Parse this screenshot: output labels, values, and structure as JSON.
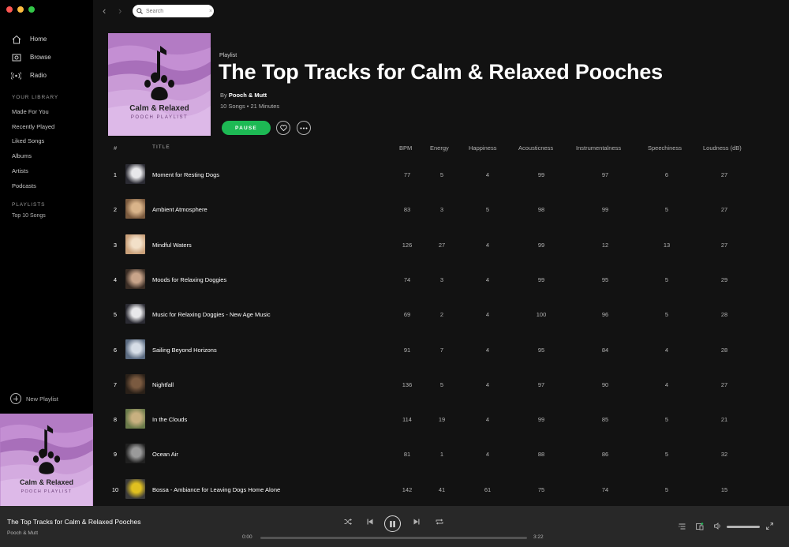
{
  "sidebar": {
    "nav": [
      {
        "label": "Home",
        "icon": "home-icon"
      },
      {
        "label": "Browse",
        "icon": "browse-icon"
      },
      {
        "label": "Radio",
        "icon": "radio-icon"
      }
    ],
    "library_heading": "YOUR LIBRARY",
    "library_items": [
      "Made For You",
      "Recently Played",
      "Liked Songs",
      "Albums",
      "Artists",
      "Podcasts"
    ],
    "playlists_heading": "PLAYLISTS",
    "playlists": [
      "Top 10 Songs"
    ],
    "new_playlist_label": "New Playlist"
  },
  "cover": {
    "title": "Calm & Relaxed",
    "subtitle": "POOCH PLAYLIST",
    "bg_color": "#b37bc4"
  },
  "search": {
    "placeholder": "Search"
  },
  "playlist": {
    "type": "Playlist",
    "title": "The Top Tracks for Calm & Relaxed Pooches",
    "by_prefix": "By",
    "owner": "Pooch & Mutt",
    "meta": "10 Songs • 21 Minutes",
    "pause_label": "PAUSE"
  },
  "table": {
    "headers": {
      "num": "#",
      "title": "TITLE",
      "bpm": "BPM",
      "energy": "Energy",
      "happiness": "Happiness",
      "acousticness": "Acousticness",
      "instrumentalness": "Instrumentalness",
      "speechiness": "Speechiness",
      "loudness": "Loudness (dB)"
    },
    "rows": [
      {
        "num": "1",
        "title": "Moment for Resting Dogs",
        "bpm": "77",
        "energy": "5",
        "happiness": "4",
        "acousticness": "99",
        "instrumentalness": "97",
        "speechiness": "6",
        "loudness": "27"
      },
      {
        "num": "2",
        "title": "Ambient Atmosphere",
        "bpm": "83",
        "energy": "3",
        "happiness": "5",
        "acousticness": "98",
        "instrumentalness": "99",
        "speechiness": "5",
        "loudness": "27"
      },
      {
        "num": "3",
        "title": "Mindful Waters",
        "bpm": "126",
        "energy": "27",
        "happiness": "4",
        "acousticness": "99",
        "instrumentalness": "12",
        "speechiness": "13",
        "loudness": "27"
      },
      {
        "num": "4",
        "title": "Moods for Relaxing Doggies",
        "bpm": "74",
        "energy": "3",
        "happiness": "4",
        "acousticness": "99",
        "instrumentalness": "95",
        "speechiness": "5",
        "loudness": "29"
      },
      {
        "num": "5",
        "title": "Music for Relaxing Doggies - New Age Music",
        "bpm": "69",
        "energy": "2",
        "happiness": "4",
        "acousticness": "100",
        "instrumentalness": "96",
        "speechiness": "5",
        "loudness": "28"
      },
      {
        "num": "6",
        "title": "Sailing Beyond Horizons",
        "bpm": "91",
        "energy": "7",
        "happiness": "4",
        "acousticness": "95",
        "instrumentalness": "84",
        "speechiness": "4",
        "loudness": "28"
      },
      {
        "num": "7",
        "title": "Nightfall",
        "bpm": "136",
        "energy": "5",
        "happiness": "4",
        "acousticness": "97",
        "instrumentalness": "90",
        "speechiness": "4",
        "loudness": "27"
      },
      {
        "num": "8",
        "title": "In the Clouds",
        "bpm": "114",
        "energy": "19",
        "happiness": "4",
        "acousticness": "99",
        "instrumentalness": "85",
        "speechiness": "5",
        "loudness": "21"
      },
      {
        "num": "9",
        "title": "Ocean Air",
        "bpm": "81",
        "energy": "1",
        "happiness": "4",
        "acousticness": "88",
        "instrumentalness": "86",
        "speechiness": "5",
        "loudness": "32"
      },
      {
        "num": "10",
        "title": "Bossa - Ambiance for Leaving Dogs Home Alone",
        "bpm": "142",
        "energy": "41",
        "happiness": "61",
        "acousticness": "75",
        "instrumentalness": "74",
        "speechiness": "5",
        "loudness": "15"
      }
    ]
  },
  "player": {
    "track_title": "The Top Tracks for Calm & Relaxed Pooches",
    "artist": "Pooch & Mutt",
    "elapsed": "0:00",
    "duration": "3:22",
    "progress": 0,
    "volume": 1.0
  },
  "colors": {
    "accent": "#1db954",
    "cover": "#b37bc4"
  }
}
